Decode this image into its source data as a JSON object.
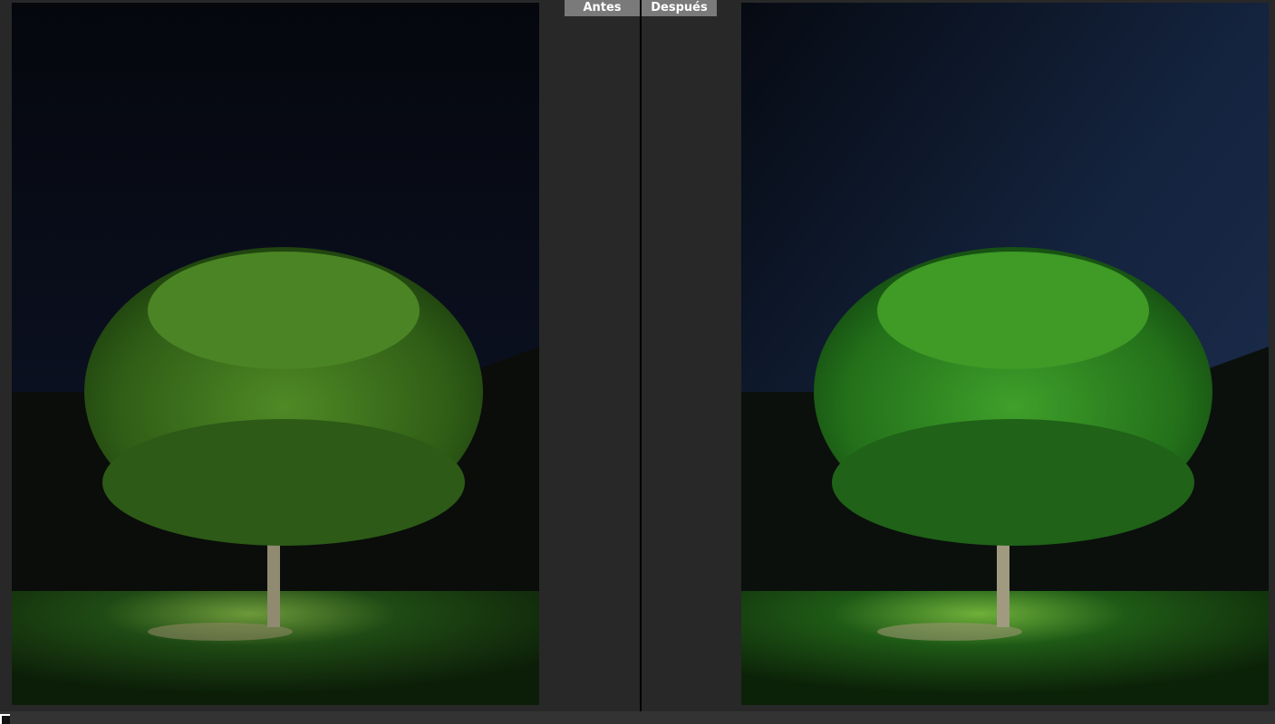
{
  "compare_view": {
    "before_label": "Antes",
    "after_label": "Después"
  },
  "colors": {
    "background": "#282828",
    "label_bg": "#7a7a7a",
    "divider": "#000000"
  }
}
